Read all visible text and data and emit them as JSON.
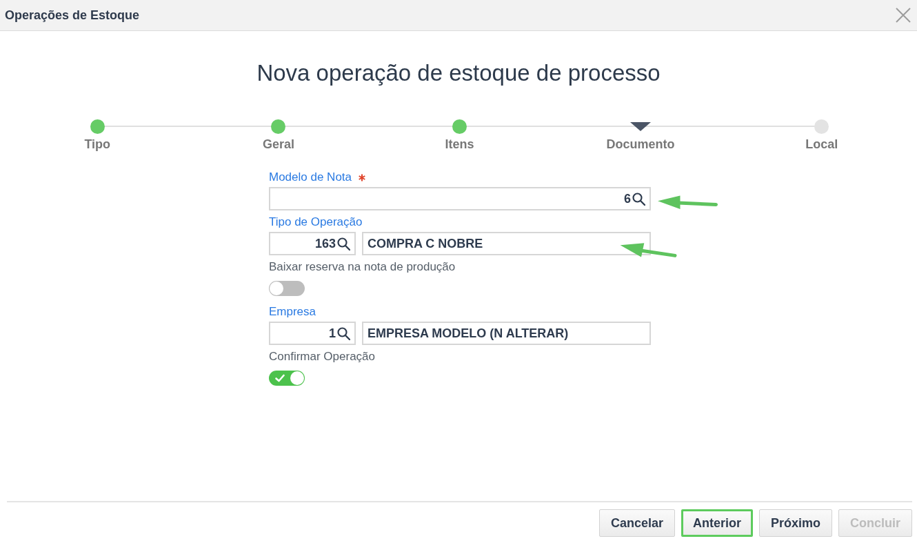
{
  "window": {
    "title": "Operações de Estoque"
  },
  "heading": "Nova operação de estoque de processo",
  "steps": [
    {
      "label": "Tipo",
      "completed": true,
      "selected": false
    },
    {
      "label": "Geral",
      "completed": true,
      "selected": false
    },
    {
      "label": "Itens",
      "completed": true,
      "selected": false
    },
    {
      "label": "Documento",
      "completed": false,
      "selected": true
    },
    {
      "label": "Local",
      "completed": false,
      "selected": false
    }
  ],
  "fields": [
    {
      "kind": "lookup",
      "label": "Modelo de Nota",
      "required": true,
      "code": "6"
    },
    {
      "kind": "lookup_pair",
      "label": "Tipo de Operação",
      "required": false,
      "code": "163",
      "description": "COMPRA C NOBRE"
    },
    {
      "kind": "toggle",
      "label": "Baixar reserva na nota de produção",
      "on": false
    },
    {
      "kind": "lookup_pair",
      "label": "Empresa",
      "required": false,
      "code": "1",
      "description": "EMPRESA MODELO (N ALTERAR)"
    },
    {
      "kind": "toggle",
      "label": "Confirmar Operação",
      "on": true
    }
  ],
  "buttons": [
    {
      "label": "Cancelar",
      "focused": false,
      "disabled": false
    },
    {
      "label": "Anterior",
      "focused": true,
      "disabled": false
    },
    {
      "label": "Próximo",
      "focused": false,
      "disabled": false
    },
    {
      "label": "Concluir",
      "focused": false,
      "disabled": true
    }
  ]
}
